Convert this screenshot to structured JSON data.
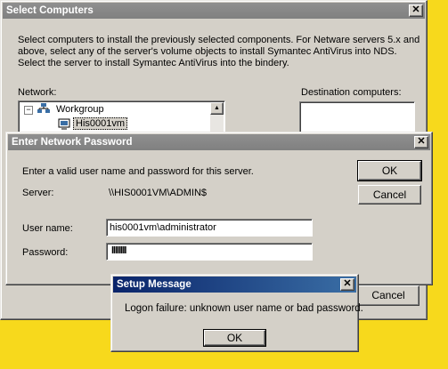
{
  "select_computers": {
    "title": "Select Computers",
    "desc_line1": "Select computers to install the previously selected components.  For Netware servers 5.x and",
    "desc_line2": "above, select any of the server's volume objects to install Symantec AntiVirus into NDS.",
    "desc_line3": "Select the server to install Symantec AntiVirus into the bindery.",
    "network_label": "Network:",
    "destination_label": "Destination computers:",
    "tree": {
      "workgroup": "Workgroup",
      "selected": "His0001vm"
    },
    "cancel_label": "Cancel"
  },
  "password_dialog": {
    "title": "Enter Network Password",
    "instruction": "Enter a valid user name and password for this server.",
    "server_label": "Server:",
    "server_value": "\\\\HIS0001VM\\ADMIN$",
    "username_label": "User name:",
    "username_value": "his0001vm\\administrator",
    "password_label": "Password:",
    "password_value": "llllllll",
    "ok_label": "OK",
    "cancel_label": "Cancel"
  },
  "setup_message": {
    "title": "Setup Message",
    "message": "Logon failure: unknown user name or bad password.",
    "ok_label": "OK"
  },
  "colors": {
    "desktop": "#f7d91c",
    "face": "#d4d0c8",
    "title_inactive": "#808080",
    "title_active": "#0a246a"
  }
}
